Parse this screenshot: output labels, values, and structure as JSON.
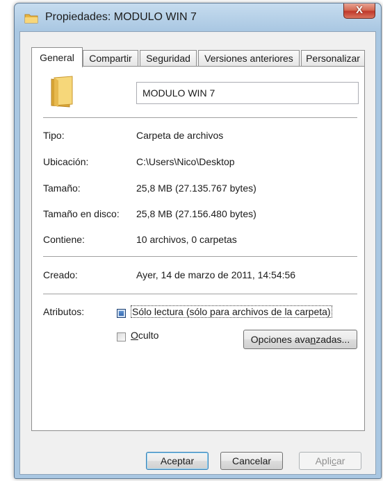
{
  "window": {
    "title": "Propiedades: MODULO WIN 7",
    "close_glyph": "X"
  },
  "tabs": [
    {
      "label": "General",
      "active": true
    },
    {
      "label": "Compartir"
    },
    {
      "label": "Seguridad"
    },
    {
      "label": "Versiones anteriores"
    },
    {
      "label": "Personalizar"
    }
  ],
  "general": {
    "name": "MODULO WIN 7",
    "fields": {
      "tipo": {
        "label": "Tipo:",
        "value": "Carpeta de archivos"
      },
      "ubicacion": {
        "label": "Ubicación:",
        "value": "C:\\Users\\Nico\\Desktop"
      },
      "tamano": {
        "label": "Tamaño:",
        "value": "25,8 MB (27.135.767 bytes)"
      },
      "tamano_disco": {
        "label": "Tamaño en disco:",
        "value": "25,8 MB (27.156.480 bytes)"
      },
      "contiene": {
        "label": "Contiene:",
        "value": "10 archivos, 0 carpetas"
      },
      "creado": {
        "label": "Creado:",
        "value": "Ayer, 14 de marzo de 2011, 14:54:56"
      }
    },
    "attributes": {
      "label": "Atributos:",
      "readonly": {
        "label": "Sólo lectura (sólo para archivos de la carpeta)",
        "state": "indeterminate"
      },
      "hidden": {
        "label_first": "O",
        "label_rest": "culto",
        "checked": false
      },
      "advanced_button": {
        "label_pre": "Opciones ava",
        "label_ul": "n",
        "label_post": "zadas..."
      }
    }
  },
  "buttons": {
    "accept": "Aceptar",
    "cancel": "Cancelar",
    "apply_pre": "Apli",
    "apply_ul": "c",
    "apply_post": "ar"
  },
  "icons": {
    "title": "folder-icon",
    "big": "folder-icon"
  },
  "colors": {
    "title_bar": "#a9c7e2",
    "close_button": "#c0392b",
    "folder": "#f2c55a"
  }
}
